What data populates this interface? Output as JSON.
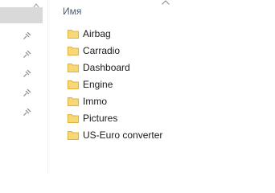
{
  "header": {
    "name_column_label": "Имя",
    "sort_icon": "chevron-up-icon"
  },
  "nav": {
    "pin_icon": "pin-icon",
    "pinned_count": 5
  },
  "folders": [
    {
      "name": "Airbag",
      "icon": "folder-icon"
    },
    {
      "name": "Carradio",
      "icon": "folder-icon"
    },
    {
      "name": "Dashboard",
      "icon": "folder-icon"
    },
    {
      "name": "Engine",
      "icon": "folder-icon"
    },
    {
      "name": "Immo",
      "icon": "folder-icon"
    },
    {
      "name": "Pictures",
      "icon": "folder-icon"
    },
    {
      "name": "US-Euro converter",
      "icon": "folder-icon"
    }
  ],
  "colors": {
    "header_text": "#4c607a",
    "folder_fill": "#f8d775",
    "folder_edge": "#e0b040",
    "selection": "#d9d9d9"
  }
}
